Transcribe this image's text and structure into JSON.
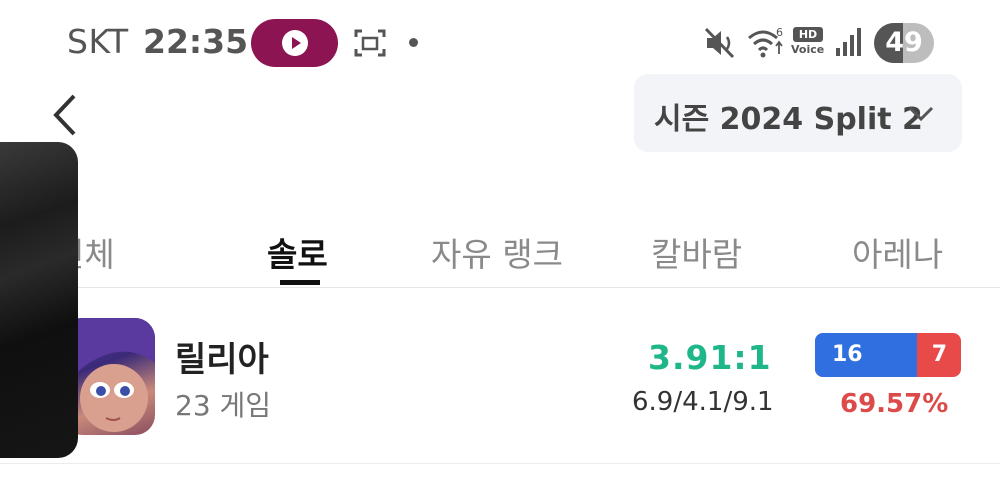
{
  "status_bar": {
    "carrier": "SKT",
    "time": "22:35",
    "battery": "49",
    "hd_label": "HD",
    "voice_label": "Voice",
    "icons": [
      "record-icon",
      "screenshot-icon",
      "dot-icon",
      "mute-icon",
      "wifi-icon",
      "hd-voice-icon",
      "signal-icon",
      "battery-icon"
    ]
  },
  "header": {
    "season_label": "시즌 2024 Split 2"
  },
  "tabs": [
    {
      "label": "전체",
      "active": false
    },
    {
      "label": "솔로",
      "active": true
    },
    {
      "label": "자유 랭크",
      "active": false
    },
    {
      "label": "칼바람",
      "active": false
    },
    {
      "label": "아레나",
      "active": false
    }
  ],
  "champion": {
    "name": "릴리아",
    "games": "23 게임",
    "kda_ratio": "3.91:1",
    "kda_detail": "6.9/4.1/9.1",
    "wins": "16",
    "losses": "7",
    "win_fraction": 0.6957,
    "winrate": "69.57%"
  },
  "colors": {
    "kda": "#1fb789",
    "win": "#2f6fe0",
    "loss": "#e84a4a",
    "winrate": "#dc4a4a",
    "record_pill": "#8c1452"
  }
}
